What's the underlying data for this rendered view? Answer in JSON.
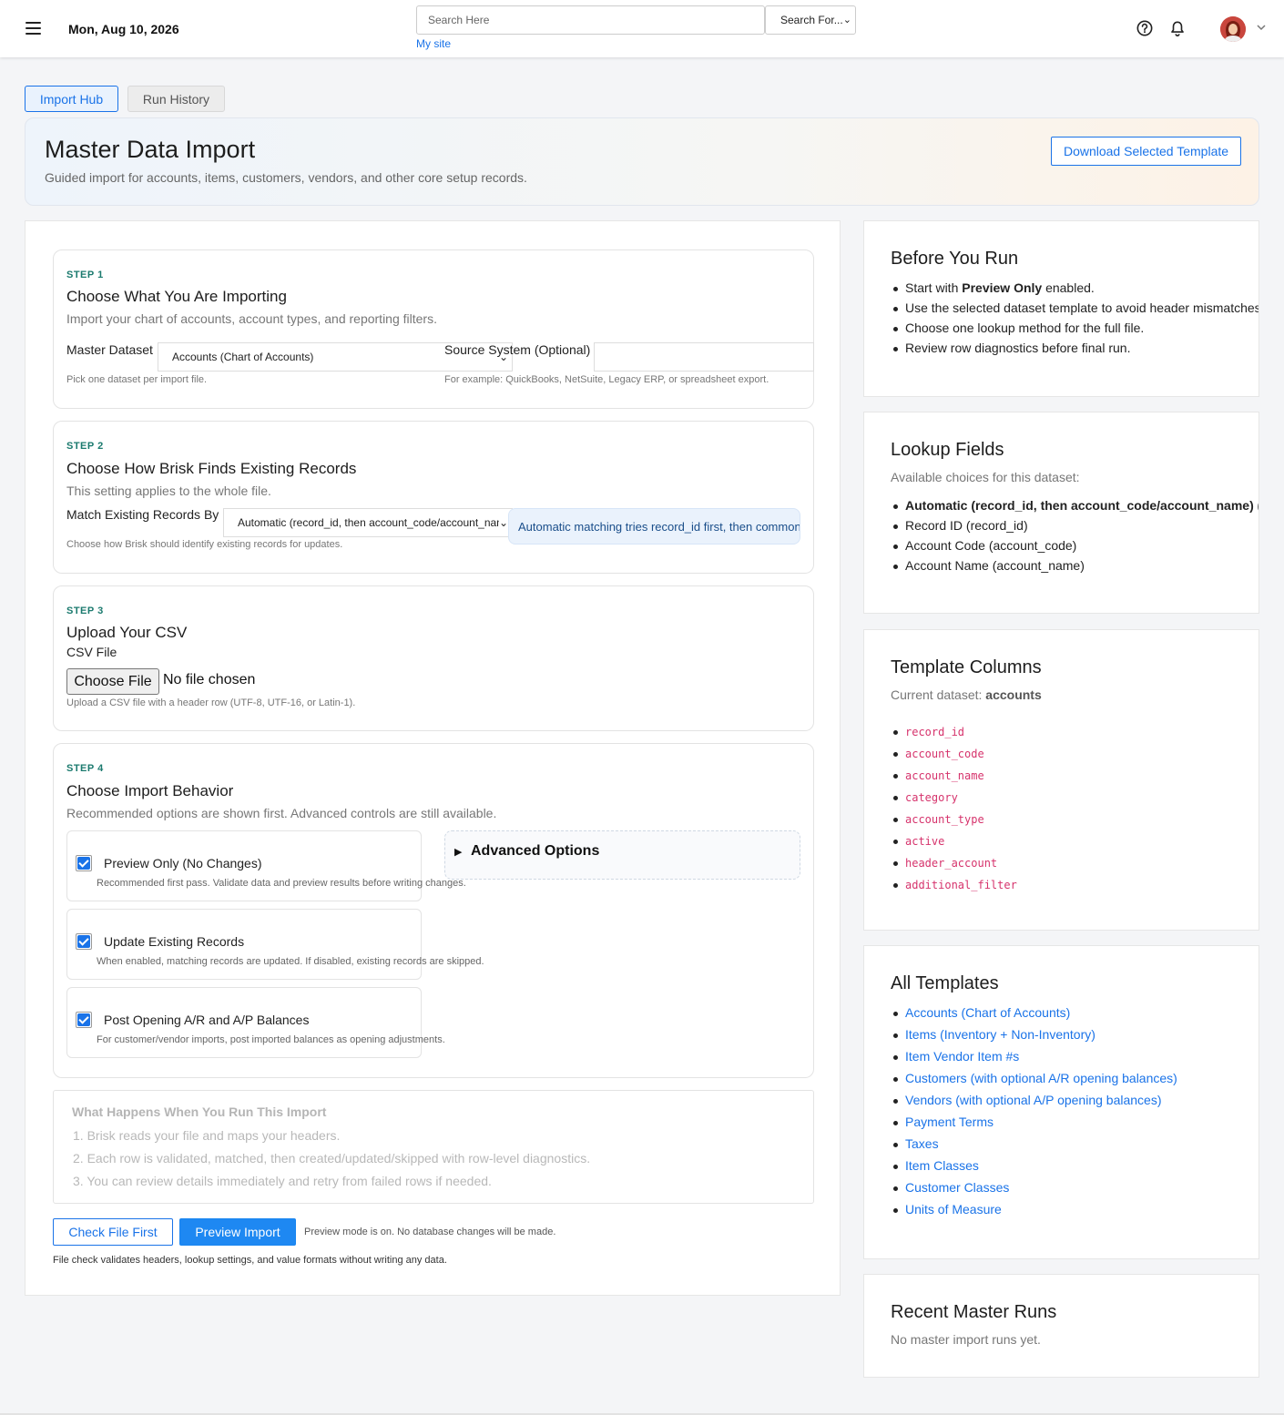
{
  "topbar": {
    "date": "Mon, Aug 10, 2026",
    "search_placeholder": "Search Here",
    "search_for": "Search For...",
    "my_site": "My site"
  },
  "tabs": [
    {
      "label": "Import Hub",
      "active": true
    },
    {
      "label": "Run History",
      "active": false
    }
  ],
  "hero": {
    "title": "Master Data Import",
    "subtitle": "Guided import for accounts, items, customers, vendors, and other core setup records.",
    "download_label": "Download Selected Template"
  },
  "step1": {
    "label": "STEP 1",
    "title": "Choose What You Are Importing",
    "desc": "Import your chart of accounts, account types, and reporting filters.",
    "dataset_label": "Master Dataset",
    "dataset_value": "Accounts (Chart of Accounts)",
    "dataset_hint": "Pick one dataset per import file.",
    "source_label": "Source System (Optional)",
    "source_value": "",
    "source_hint": "For example: QuickBooks, NetSuite, Legacy ERP, or spreadsheet export."
  },
  "step2": {
    "label": "STEP 2",
    "title": "Choose How Brisk Finds Existing Records",
    "desc": "This setting applies to the whole file.",
    "match_label": "Match Existing Records By",
    "match_value": "Automatic (record_id, then account_code/account_name)",
    "match_hint": "Choose how Brisk should identify existing records for updates.",
    "info": "Automatic matching tries record_id first, then common dataset keys."
  },
  "step3": {
    "label": "STEP 3",
    "title": "Upload Your CSV",
    "file_label": "CSV File",
    "choose_file": "Choose File",
    "no_file": "No file chosen",
    "hint": "Upload a CSV file with a header row (UTF-8, UTF-16, or Latin-1)."
  },
  "step4": {
    "label": "STEP 4",
    "title": "Choose Import Behavior",
    "desc": "Recommended options are shown first. Advanced controls are still available.",
    "options": [
      {
        "title": "Preview Only (No Changes)",
        "desc": "Recommended first pass. Validate data and preview results before writing changes.",
        "checked": true
      },
      {
        "title": "Update Existing Records",
        "desc": "When enabled, matching records are updated. If disabled, existing records are skipped.",
        "checked": true
      },
      {
        "title": "Post Opening A/R and A/P Balances",
        "desc": "For customer/vendor imports, post imported balances as opening adjustments.",
        "checked": true
      }
    ],
    "advanced_label": "Advanced Options"
  },
  "what_happens": {
    "title": "What Happens When You Run This Import",
    "items": [
      "1. Brisk reads your file and maps your headers.",
      "2. Each row is validated, matched, then created/updated/skipped with row-level diagnostics.",
      "3. You can review details immediately and retry from failed rows if needed."
    ]
  },
  "actions": {
    "check_label": "Check File First",
    "preview_label": "Preview Import",
    "preview_note": "Preview mode is on. No database changes will be made.",
    "filecheck_note": "File check validates headers, lookup settings, and value formats without writing any data."
  },
  "before_run": {
    "title": "Before You Run",
    "items": [
      {
        "pre": "Start with ",
        "bold": "Preview Only",
        "post": " enabled."
      },
      {
        "pre": "Use the selected dataset template to avoid header mismatches.",
        "bold": "",
        "post": ""
      },
      {
        "pre": "Choose one lookup method for the full file.",
        "bold": "",
        "post": ""
      },
      {
        "pre": "Review row diagnostics before final run.",
        "bold": "",
        "post": ""
      }
    ]
  },
  "lookup_fields": {
    "title": "Lookup Fields",
    "sub": "Available choices for this dataset:",
    "items": [
      "Automatic (record_id, then account_code/account_name) (default)",
      "Record ID (record_id)",
      "Account Code (account_code)",
      "Account Name (account_name)"
    ]
  },
  "template_columns": {
    "title": "Template Columns",
    "sub_prefix": "Current dataset: ",
    "dataset": "accounts",
    "columns": [
      "record_id",
      "account_code",
      "account_name",
      "category",
      "account_type",
      "active",
      "header_account",
      "additional_filter"
    ]
  },
  "all_templates": {
    "title": "All Templates",
    "items": [
      "Accounts (Chart of Accounts)",
      "Items (Inventory + Non-Inventory)",
      "Item Vendor Item #s",
      "Customers (with optional A/R opening balances)",
      "Vendors (with optional A/P opening balances)",
      "Payment Terms",
      "Taxes",
      "Item Classes",
      "Customer Classes",
      "Units of Measure"
    ]
  },
  "recent_runs": {
    "title": "Recent Master Runs",
    "empty": "No master import runs yet."
  },
  "colors": {
    "accent": "#1a73e8",
    "step_label": "#1b7a6e",
    "code": "#d6336c"
  }
}
